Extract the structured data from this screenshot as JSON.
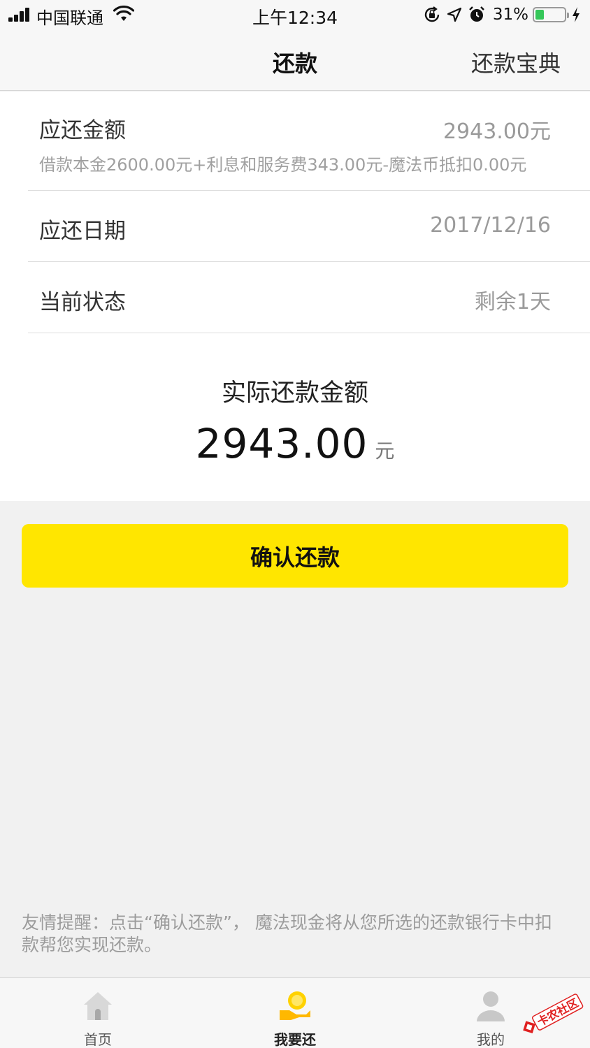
{
  "status_bar": {
    "carrier": "中国联通",
    "time": "上午12:34",
    "battery_percent": "31%",
    "battery_level": 0.31
  },
  "nav": {
    "title": "还款",
    "right_link": "还款宝典"
  },
  "details": {
    "amount_due": {
      "label": "应还金额",
      "value": "2943.00元",
      "breakdown": "借款本金2600.00元+利息和服务费343.00元-魔法币抵扣0.00元"
    },
    "due_date": {
      "label": "应还日期",
      "value": "2017/12/16"
    },
    "status": {
      "label": "当前状态",
      "value": "剩余1天"
    }
  },
  "actual_payment": {
    "label": "实际还款金额",
    "amount": "2943.00",
    "unit": "元"
  },
  "confirm_button": {
    "label": "确认还款",
    "color": "#ffe600"
  },
  "reminder": "友情提醒：点击“确认还款”， 魔法现金将从您所选的还款银行卡中扣款帮您实现还款。",
  "tab_bar": {
    "tabs": [
      {
        "label": "首页",
        "icon": "home-icon",
        "active": false
      },
      {
        "label": "我要还",
        "icon": "repay-icon",
        "active": true
      },
      {
        "label": "我的",
        "icon": "profile-icon",
        "active": false
      }
    ]
  },
  "watermark": "卡农社区"
}
